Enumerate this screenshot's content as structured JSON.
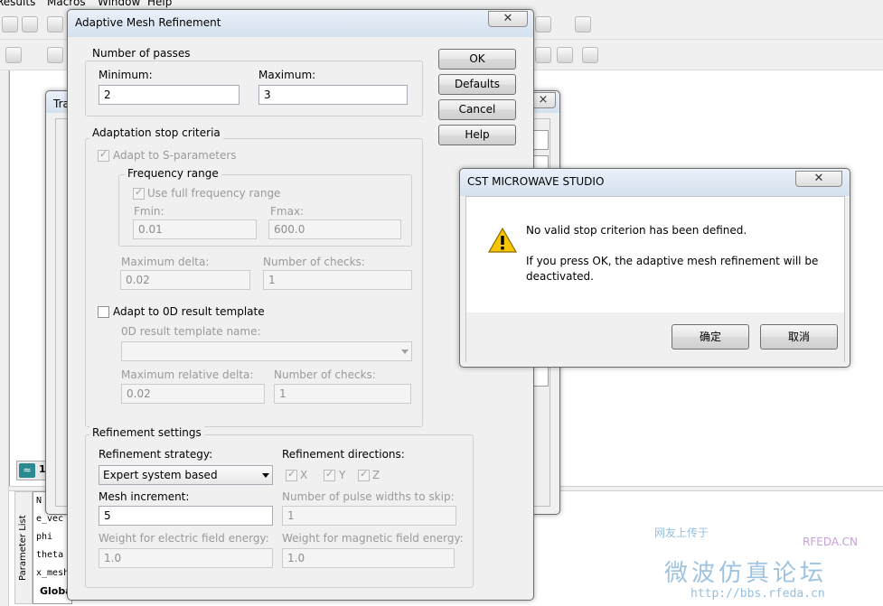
{
  "app": {
    "menu": [
      "Results",
      "Macros",
      "Window",
      "Help"
    ],
    "param_list": {
      "tab_label": "Parameter List",
      "rows": [
        "N",
        "e_vec",
        "phi",
        "theta",
        "x_mesh"
      ],
      "global_tab": "Global"
    },
    "nav_number": "1"
  },
  "trace_window": {
    "title": "Tra"
  },
  "amr_dialog": {
    "title": "Adaptive Mesh Refinement",
    "buttons": {
      "ok": "OK",
      "defaults": "Defaults",
      "cancel": "Cancel",
      "help": "Help"
    },
    "passes": {
      "group_label": "Number of passes",
      "min_label": "Minimum:",
      "min_value": "2",
      "max_label": "Maximum:",
      "max_value": "3"
    },
    "stop": {
      "group_label": "Adaptation stop criteria",
      "adapt_s_label": "Adapt to S-parameters",
      "freq_group_label": "Frequency range",
      "use_full_label": "Use full frequency range",
      "fmin_label": "Fmin:",
      "fmin_value": "0.01",
      "fmax_label": "Fmax:",
      "fmax_value": "600.0",
      "max_delta_label": "Maximum delta:",
      "max_delta_value": "0.02",
      "num_checks_label": "Number of checks:",
      "num_checks_value": "1",
      "adapt_0d_label": "Adapt to 0D result template",
      "template_name_label": "0D result template name:",
      "template_name_value": "",
      "max_rel_delta_label": "Maximum relative delta:",
      "max_rel_delta_value": "0.02",
      "num_checks2_label": "Number of checks:",
      "num_checks2_value": "1"
    },
    "refine": {
      "group_label": "Refinement settings",
      "strategy_label": "Refinement strategy:",
      "strategy_value": "Expert system based",
      "directions_label": "Refinement directions:",
      "dir_x": "X",
      "dir_y": "Y",
      "dir_z": "Z",
      "mesh_inc_label": "Mesh increment:",
      "mesh_inc_value": "5",
      "pulse_label": "Number of pulse widths to skip:",
      "pulse_value": "1",
      "weight_e_label": "Weight for electric field energy:",
      "weight_e_value": "1.0",
      "weight_m_label": "Weight for magnetic field energy:",
      "weight_m_value": "1.0"
    }
  },
  "message_box": {
    "title": "CST MICROWAVE STUDIO",
    "line1": "No valid stop criterion has been defined.",
    "line2": "If you press OK, the adaptive mesh refinement will be",
    "line3": "deactivated.",
    "ok_label": "确定",
    "cancel_label": "取消",
    "icon": "warning-icon"
  },
  "watermark": {
    "top": "网友上传于",
    "brand": "RFEDA.CN",
    "chinese": "微波仿真论坛",
    "url": "http://bbs.rfeda.cn"
  }
}
